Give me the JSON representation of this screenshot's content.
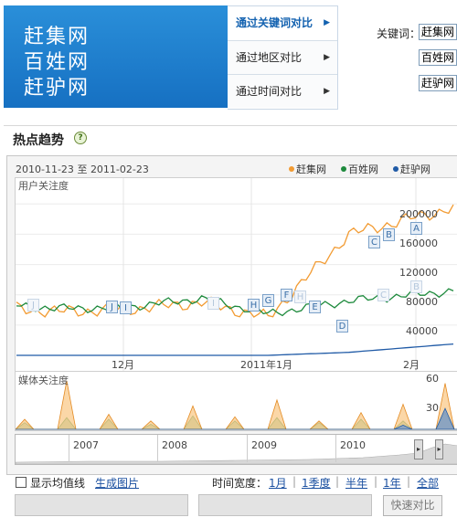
{
  "header": {
    "brands": [
      "赶集网",
      "百姓网",
      "赶驴网"
    ],
    "menu": [
      {
        "label": "通过关键词对比",
        "active": true
      },
      {
        "label": "通过地区对比",
        "active": false
      },
      {
        "label": "通过时间对比",
        "active": false
      }
    ],
    "keyword_label": "关键词：",
    "keywords": [
      "赶集网",
      "百姓网",
      "赶驴网"
    ]
  },
  "section": {
    "title": "热点趋势",
    "help_icon": "help-icon"
  },
  "chart": {
    "date_start": "2010-11-23",
    "date_sep": "至",
    "date_end": "2011-02-23",
    "user_label": "用户关注度",
    "media_label": "媒体关注度",
    "legend": [
      {
        "name": "赶集网",
        "color": "#f29b32"
      },
      {
        "name": "百姓网",
        "color": "#1d8a3c"
      },
      {
        "name": "赶驴网",
        "color": "#1f5aa6"
      }
    ],
    "y_ticks": [
      "200000",
      "160000",
      "120000",
      "80000",
      "40000"
    ],
    "x_ticks": [
      "12月",
      "2011年1月",
      "2月"
    ],
    "media_ticks": [
      "60",
      "30"
    ],
    "nav_years": [
      "2007",
      "2008",
      "2009",
      "2010"
    ],
    "flags": [
      "J",
      "J",
      "I",
      "I",
      "H",
      "G",
      "F",
      "H",
      "E",
      "D",
      "C",
      "B",
      "A",
      "B",
      "C"
    ]
  },
  "chart_data": {
    "type": "line",
    "title": "",
    "ylabel": "用户关注度",
    "ylim": [
      0,
      210000
    ],
    "x": [
      "2010-11-23",
      "2010-12-01",
      "2010-12-15",
      "2011-01-01",
      "2011-01-15",
      "2011-02-01",
      "2011-02-23"
    ],
    "series": [
      {
        "name": "赶集网",
        "values": [
          62000,
          58000,
          60000,
          70000,
          50000,
          160000,
          195000
        ]
      },
      {
        "name": "百姓网",
        "values": [
          66000,
          62000,
          63000,
          75000,
          55000,
          72000,
          85000
        ]
      },
      {
        "name": "赶驴网",
        "values": [
          0,
          0,
          0,
          0,
          0,
          4000,
          15000
        ]
      }
    ],
    "media_series": {
      "ylim": [
        0,
        60
      ],
      "赶集网": [
        12,
        58,
        18,
        10,
        28,
        15,
        35,
        10,
        20,
        30,
        55
      ],
      "百姓网": [
        8,
        14,
        12,
        6,
        16,
        10,
        14,
        8,
        12,
        10,
        20
      ],
      "赶驴网": [
        0,
        0,
        0,
        0,
        0,
        0,
        0,
        0,
        0,
        5,
        25
      ]
    },
    "grid": true,
    "legend": "top-right"
  },
  "controls": {
    "avg_line_label": "显示均值线",
    "generate_image": "生成图片",
    "span_label": "时间宽度：",
    "spans": [
      "1月",
      "1季度",
      "半年",
      "1年",
      "全部"
    ],
    "compare_button": "快速对比"
  }
}
